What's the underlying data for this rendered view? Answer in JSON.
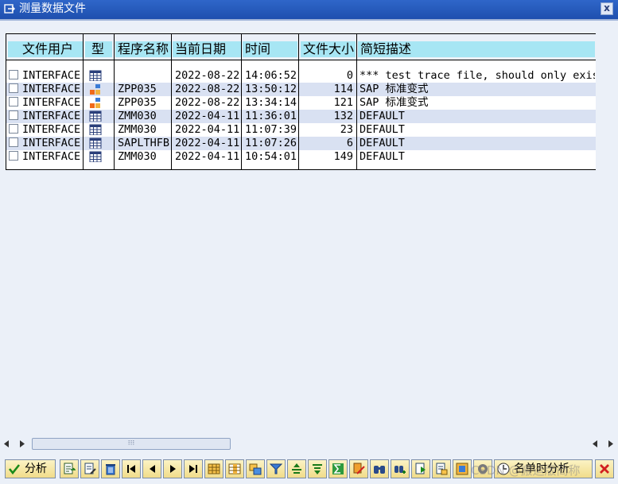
{
  "window": {
    "title": "测量数据文件",
    "close_label": "x"
  },
  "table": {
    "headers": [
      "文件用户",
      "型",
      "程序名称",
      "当前日期",
      "时间",
      "文件大小",
      "简短描述"
    ],
    "rows": [
      {
        "user": "INTERFACE",
        "type": "grid",
        "program": "",
        "date": "2022-08-22",
        "time": "14:06:52",
        "size": "0",
        "desc": "*** test trace file, should only exis"
      },
      {
        "user": "INTERFACE",
        "type": "blocks",
        "program": "ZPP035",
        "date": "2022-08-22",
        "time": "13:50:12",
        "size": "114",
        "desc": "SAP 标准变式"
      },
      {
        "user": "INTERFACE",
        "type": "blocks",
        "program": "ZPP035",
        "date": "2022-08-22",
        "time": "13:34:14",
        "size": "121",
        "desc": "SAP 标准变式"
      },
      {
        "user": "INTERFACE",
        "type": "grid",
        "program": "ZMM030",
        "date": "2022-04-11",
        "time": "11:36:01",
        "size": "132",
        "desc": "DEFAULT"
      },
      {
        "user": "INTERFACE",
        "type": "grid",
        "program": "ZMM030",
        "date": "2022-04-11",
        "time": "11:07:39",
        "size": "23",
        "desc": "DEFAULT"
      },
      {
        "user": "INTERFACE",
        "type": "grid",
        "program": "SAPLTHFB",
        "date": "2022-04-11",
        "time": "11:07:26",
        "size": "6",
        "desc": "DEFAULT"
      },
      {
        "user": "INTERFACE",
        "type": "grid",
        "program": "ZMM030",
        "date": "2022-04-11",
        "time": "10:54:01",
        "size": "149",
        "desc": "DEFAULT"
      }
    ]
  },
  "toolbar": {
    "analyze_label": "分析",
    "time_analysis_label": "名单时分析",
    "watermark": "CSDN @搬运版简称"
  },
  "colors": {
    "header_cell": "#a7e6f4",
    "alt_row": "#d9e1f2",
    "title_bar": "#2f66c9",
    "button": "#f6e6a6"
  }
}
